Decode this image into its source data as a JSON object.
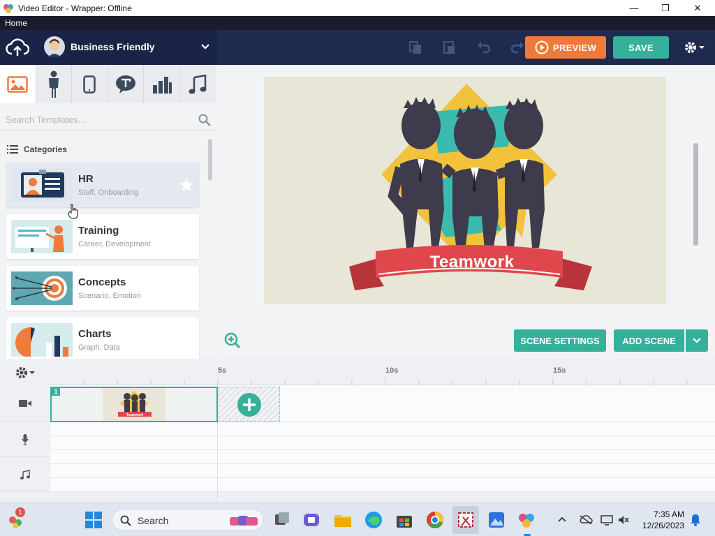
{
  "window": {
    "title": "Video Editor - Wrapper: Offline",
    "minimize": "—",
    "maximize": "❐",
    "close": "✕"
  },
  "menu": {
    "home": "Home"
  },
  "header": {
    "theme_name": "Business Friendly",
    "preview_label": "PREVIEW",
    "save_label": "SAVE"
  },
  "sidebar": {
    "tabs": [
      "image-icon",
      "character-icon",
      "mobile-icon",
      "speech-bubble-icon",
      "bar-chart-icon",
      "music-note-icon"
    ],
    "search_placeholder": "Search Templates...",
    "categories_label": "Categories",
    "cards": [
      {
        "title": "HR",
        "subtitle": "Staff, Onboarding"
      },
      {
        "title": "Training",
        "subtitle": "Career, Development"
      },
      {
        "title": "Concepts",
        "subtitle": "Scenario, Emotion"
      },
      {
        "title": "Charts",
        "subtitle": "Graph, Data"
      }
    ]
  },
  "stage": {
    "banner_text": "Teamwork",
    "scene_settings_label": "SCENE SETTINGS",
    "add_scene_label": "ADD SCENE"
  },
  "timeline": {
    "ruler": [
      "5s",
      "10s",
      "15s"
    ],
    "scene_number": "1",
    "thumb_banner": "Teamwork"
  },
  "taskbar": {
    "search_label": "Search",
    "notification_count": "1",
    "time": "7:35 AM",
    "date": "12/26/2023"
  },
  "colors": {
    "accent_teal": "#35b09a",
    "preview_orange": "#f07a3a",
    "header_navy": "#1e2b4f",
    "banner_red": "#e0474c"
  }
}
